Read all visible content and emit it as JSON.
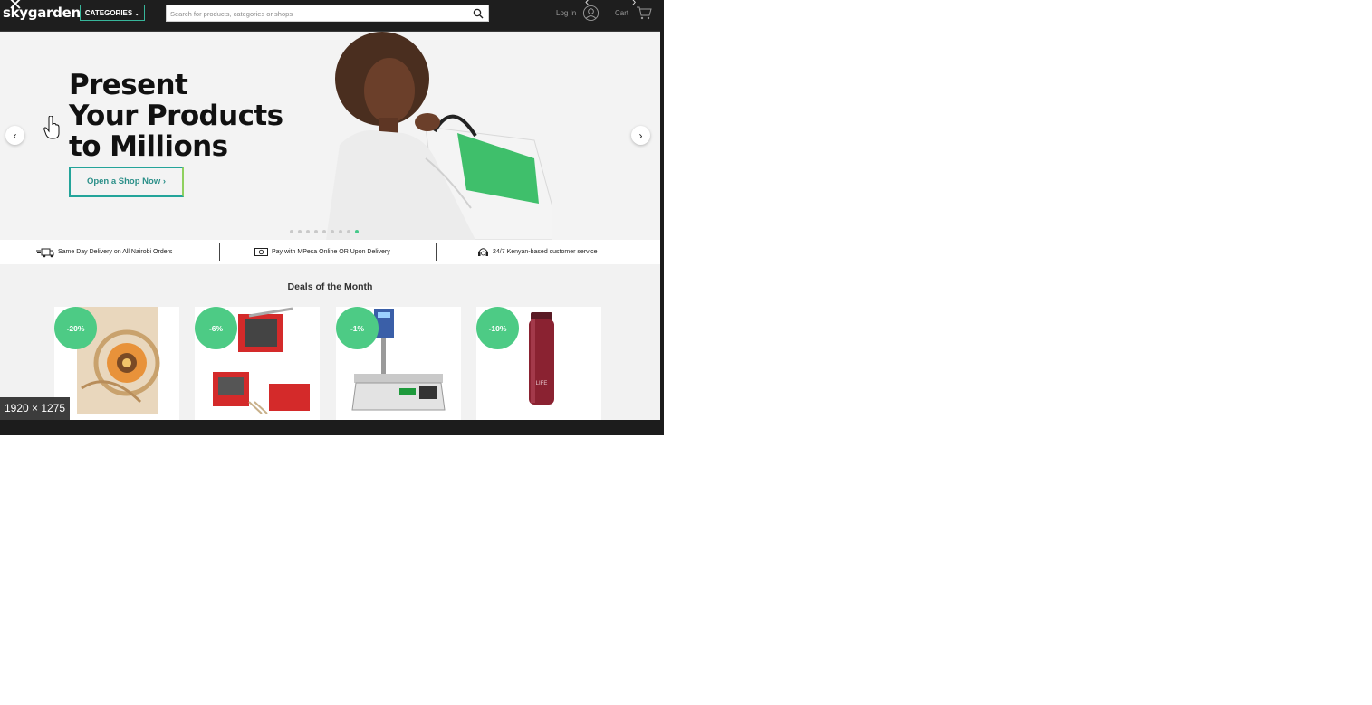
{
  "header": {
    "logo_text": "skygarden",
    "categories_label": "CATEGORIES",
    "search": {
      "placeholder": "Search for products, categories or shops",
      "value": ""
    },
    "login_label": "Log In",
    "cart_label": "Cart"
  },
  "hero": {
    "title_lines": [
      "Present",
      "Your Products",
      "to Millions"
    ],
    "cta_label": "Open a Shop Now",
    "slide_count": 9,
    "active_slide": 9
  },
  "features": [
    {
      "icon": "delivery-icon",
      "text": "Same Day Delivery on All Nairobi Orders"
    },
    {
      "icon": "cash-icon",
      "text": "Pay with MPesa Online OR Upon Delivery"
    },
    {
      "icon": "support-icon",
      "text": "24/7 Kenyan-based customer service"
    }
  ],
  "deals": {
    "title": "Deals of the Month",
    "items": [
      {
        "badge": "-20%",
        "image": "cushion-image"
      },
      {
        "badge": "-6%",
        "image": "chip-cutter-image"
      },
      {
        "badge": "-1%",
        "image": "digital-scale-image"
      },
      {
        "badge": "-10%",
        "image": "thermos-bottle-image",
        "bottle_text": "LIFE"
      }
    ]
  },
  "viewer": {
    "dimensions_label": "1920 × 1275",
    "close_glyph": "✕",
    "prev_glyph": "‹",
    "next_glyph": "›"
  },
  "colors": {
    "accent": "#4dcb85",
    "header_bg": "#1e1e1e",
    "cta_border": "#23a49a"
  }
}
